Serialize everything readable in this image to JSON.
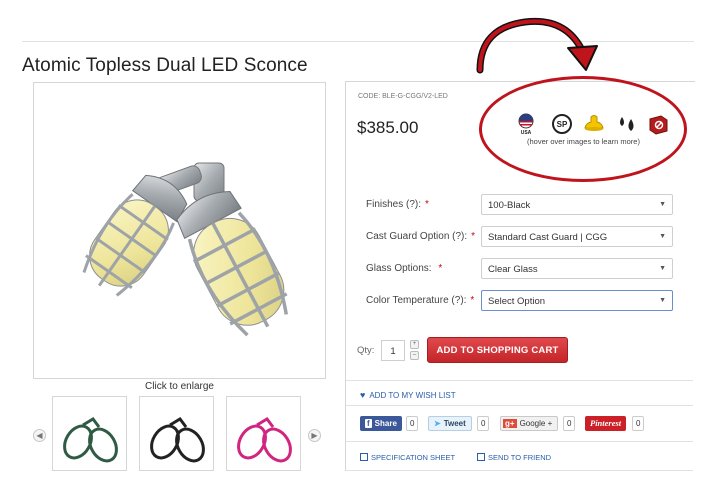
{
  "product": {
    "title": "Atomic Topless Dual LED Sconce",
    "code": "CODE: BLE-G-CGG/V2-LED",
    "price": "$385.00",
    "enlarge_caption": "Click to enlarge"
  },
  "badges": [
    {
      "icon": "usa-flag-icon",
      "label": "USA"
    },
    {
      "icon": "csa-certification-icon",
      "label": "CSA"
    },
    {
      "icon": "dimmable-lamp-icon",
      "label": ""
    },
    {
      "icon": "wet-location-drops-icon",
      "label": ""
    },
    {
      "icon": "vandal-resistant-icon",
      "label": ""
    }
  ],
  "hover_note": "(hover over images to learn more)",
  "options": [
    {
      "label": "Finishes",
      "help": "(?):",
      "required": "*",
      "value": "100-Black"
    },
    {
      "label": "Cast Guard Option",
      "help": "(?):",
      "required": "*",
      "value": "Standard Cast Guard | CGG"
    },
    {
      "label": "Glass Options:",
      "help": "",
      "required": "*",
      "value": "Clear Glass"
    },
    {
      "label": "Color Temperature",
      "help": "(?):",
      "required": "*",
      "value": "Select Option"
    }
  ],
  "cart": {
    "qty_label": "Qty:",
    "qty_value": "1",
    "add_to_cart": "ADD TO SHOPPING CART"
  },
  "wishlist": "ADD TO MY WISH LIST",
  "social": {
    "facebook_label": "Share",
    "facebook_count": "0",
    "twitter_label": "Tweet",
    "twitter_count": "0",
    "google_label": "Google +",
    "google_count": "0",
    "pinterest_label": "Pinterest",
    "pinterest_count": "0"
  },
  "links": {
    "spec_sheet": "SPECIFICATION SHEET",
    "send_friend": "SEND TO FRIEND"
  },
  "colors": {
    "accent_red": "#c42529",
    "link_blue": "#2a5ea8",
    "facebook": "#3b5998",
    "twitter": "#55acee",
    "google": "#dd4b39",
    "pinterest": "#cb2027",
    "annotation": "#c0141d"
  },
  "thumbnails": [
    {
      "finish": "green"
    },
    {
      "finish": "black"
    },
    {
      "finish": "pink"
    }
  ]
}
